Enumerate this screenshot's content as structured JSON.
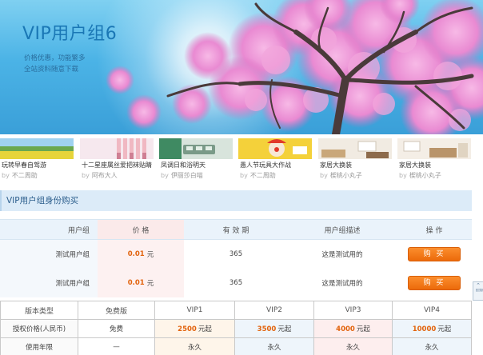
{
  "hero": {
    "title": "VIP用户组6",
    "line1": "价格优惠，功能繁多",
    "line2": "全站资料随意下载"
  },
  "thumbs": [
    {
      "title": "玩转早春自驾游",
      "author": "不二周助",
      "scene": "meadow"
    },
    {
      "title": "十二星座属丝爱把袜贴睛",
      "author": "阿布大人",
      "scene": "legs"
    },
    {
      "title": "凤调日和浴明天",
      "author": "伊丽莎白喵",
      "scene": "tram"
    },
    {
      "title": "愚人节玩具大作战",
      "author": "不二周助",
      "scene": "clown"
    },
    {
      "title": "家居大换装",
      "author": "楔桃小丸子",
      "scene": "room"
    },
    {
      "title": "家居大换装",
      "author": "楔桃小丸子",
      "scene": "room2"
    }
  ],
  "by_label": "by",
  "purchase": {
    "section_title": "VIP用户组身份购买",
    "headers": {
      "group": "用户组",
      "price": "价 格",
      "period": "有 效 期",
      "desc": "用户组描述",
      "op": "操 作"
    },
    "rows": [
      {
        "group": "测试用户组",
        "price": "0.01",
        "unit": "元",
        "period": "365",
        "desc": "这是测试用的",
        "button": "购 买"
      },
      {
        "group": "测试用户组",
        "price": "0.01",
        "unit": "元",
        "period": "365",
        "desc": "这是测试用的",
        "button": "购 买"
      }
    ]
  },
  "side_tab": {
    "label": "回顶部"
  },
  "versions": {
    "headers": [
      "版本类型",
      "免费版",
      "VIP1",
      "VIP2",
      "VIP3",
      "VIP4"
    ],
    "price_row": {
      "label": "授权价格(人民币)",
      "free": "免费",
      "values": [
        "2500",
        "3500",
        "4000",
        "10000"
      ],
      "suffixes": [
        "元起",
        "元起",
        "元起",
        "元起"
      ]
    },
    "period_row": {
      "label": "使用年限",
      "values": [
        "—",
        "永久",
        "永久",
        "永久",
        "永久"
      ]
    }
  }
}
